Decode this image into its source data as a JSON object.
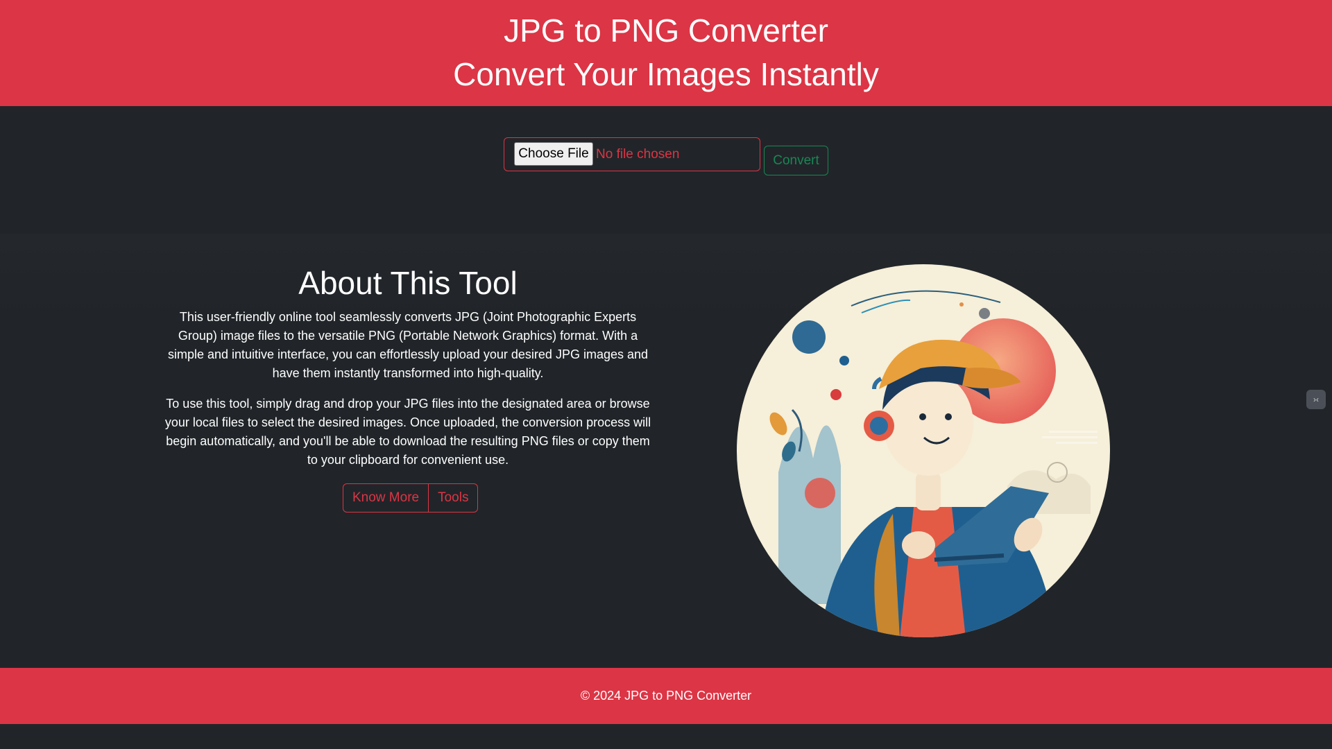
{
  "header": {
    "title": "JPG to PNG Converter",
    "subtitle": "Convert Your Images Instantly"
  },
  "upload": {
    "choose_file_label": "Choose File",
    "file_status": "No file chosen",
    "convert_label": "Convert"
  },
  "about": {
    "title": "About This Tool",
    "paragraph1": "This user-friendly online tool seamlessly converts JPG (Joint Photographic Experts Group) image files to the versatile PNG (Portable Network Graphics) format. With a simple and intuitive interface, you can effortlessly upload your desired JPG images and have them instantly transformed into high-quality.",
    "paragraph2": "To use this tool, simply drag and drop your JPG files into the designated area or browse your local files to select the desired images. Once uploaded, the conversion process will begin automatically, and you'll be able to download the resulting PNG files or copy them to your clipboard for convenient use.",
    "know_more_label": "Know More",
    "tools_label": "Tools"
  },
  "footer": {
    "copyright": "© 2024 JPG to PNG Converter"
  },
  "side_toggle": {
    "icon": "code-toggle-icon",
    "glyph": "›‹"
  },
  "colors": {
    "primary": "#dc3545",
    "success": "#198754",
    "dark_bg": "#212529",
    "text": "#ffffff"
  }
}
